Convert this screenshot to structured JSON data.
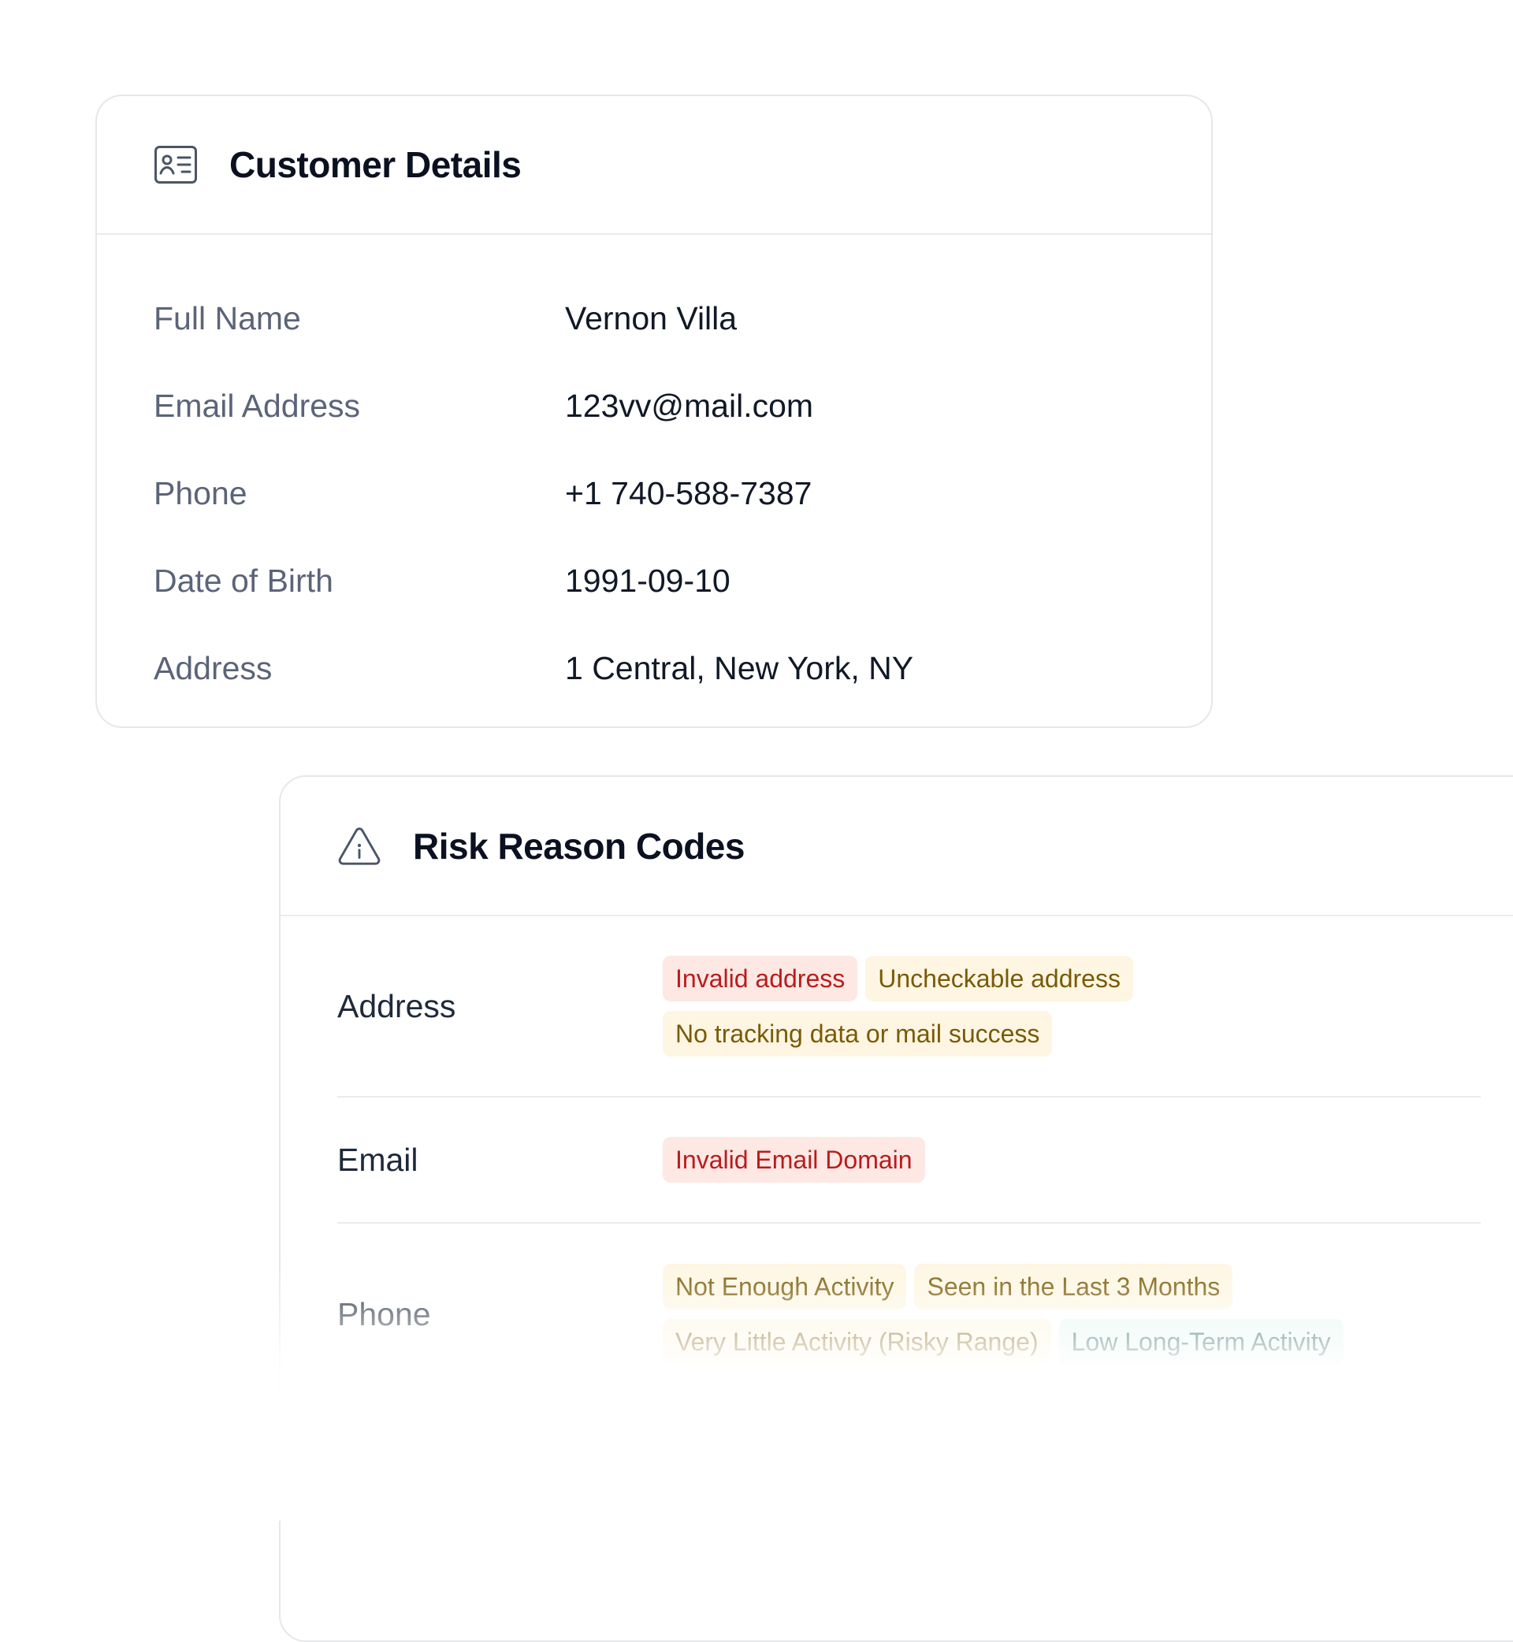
{
  "customer_details": {
    "title": "Customer Details",
    "icon": "id-card-icon",
    "rows": [
      {
        "label": "Full Name",
        "value": "Vernon Villa"
      },
      {
        "label": "Email Address",
        "value": "123vv@mail.com"
      },
      {
        "label": "Phone",
        "value": "+1 740-588-7387"
      },
      {
        "label": "Date of Birth",
        "value": "1991-09-10"
      },
      {
        "label": "Address",
        "value": "1 Central, New York, NY"
      }
    ]
  },
  "risk_reason_codes": {
    "title": "Risk Reason Codes",
    "icon": "warning-triangle-icon",
    "rows": [
      {
        "label": "Address",
        "tags": [
          {
            "text": "Invalid address",
            "severity": "red"
          },
          {
            "text": "Uncheckable address",
            "severity": "amber"
          },
          {
            "text": "No tracking data or mail success",
            "severity": "amber"
          }
        ]
      },
      {
        "label": "Email",
        "tags": [
          {
            "text": "Invalid Email Domain",
            "severity": "red"
          }
        ]
      },
      {
        "label": "Phone",
        "tags": [
          {
            "text": "Not Enough Activity",
            "severity": "amber"
          },
          {
            "text": "Seen in the Last 3 Months",
            "severity": "amber"
          },
          {
            "text": "Very Little Activity (Risky Range)",
            "severity": "amber"
          },
          {
            "text": "Low Long-Term Activity",
            "severity": "green"
          }
        ]
      }
    ]
  },
  "colors": {
    "tag_red_bg": "#fde8e4",
    "tag_red_text": "#b91c1c",
    "tag_amber_bg": "#fef6e2",
    "tag_amber_text": "#7a5a08",
    "tag_green_bg": "#e6f8f3",
    "tag_green_text": "#134e4a",
    "border": "#e5e7eb"
  }
}
